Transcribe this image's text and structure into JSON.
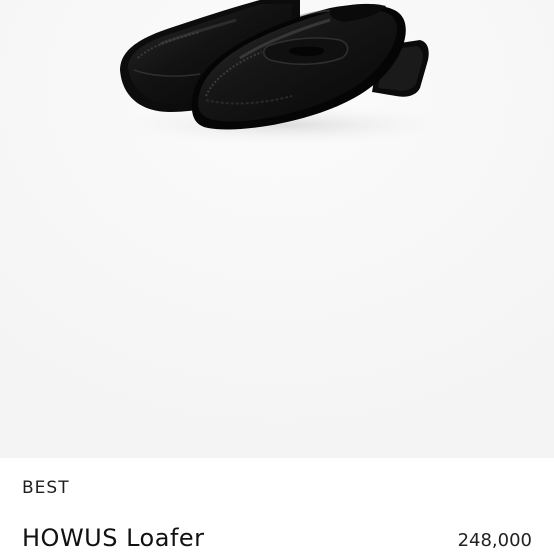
{
  "product": {
    "badge": "BEST",
    "name": "HOWUS Loafer",
    "price": "248,000",
    "image_subject": "black-leather-penny-loafers"
  },
  "colors": {
    "image_background": "#f7f7f7",
    "panel_background": "#ffffff",
    "shoe_leather": "#151515",
    "text": "#111111"
  }
}
